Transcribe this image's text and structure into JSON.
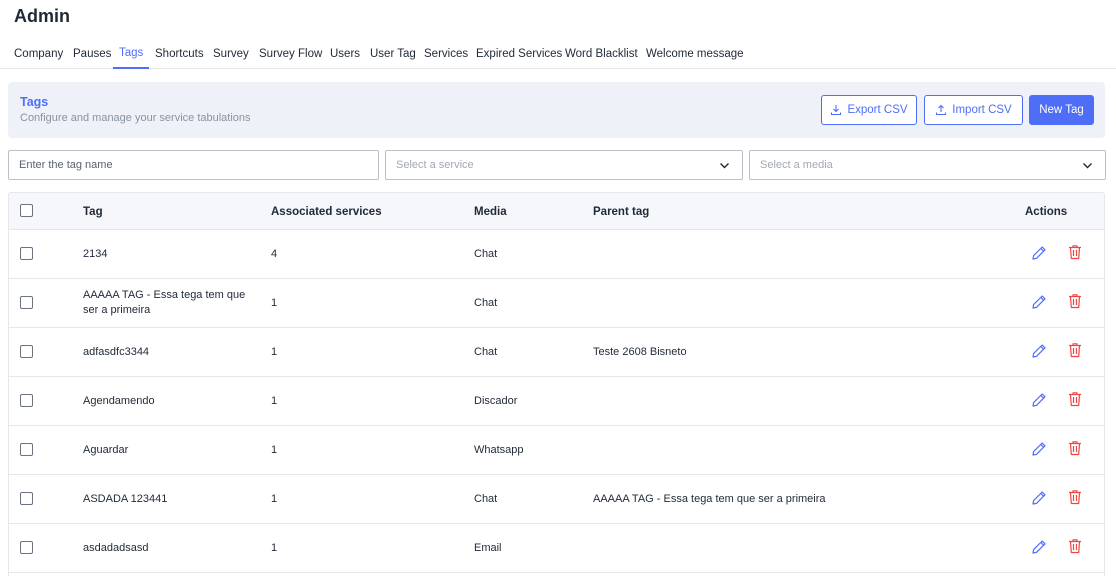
{
  "page": {
    "title": "Admin"
  },
  "tabs": [
    {
      "label": "Company",
      "active": false
    },
    {
      "label": "Pauses",
      "active": false
    },
    {
      "label": "Tags",
      "active": true
    },
    {
      "label": "Shortcuts",
      "active": false
    },
    {
      "label": "Survey",
      "active": false
    },
    {
      "label": "Survey Flow",
      "active": false
    },
    {
      "label": "Users",
      "active": false
    },
    {
      "label": "User Tag",
      "active": false
    },
    {
      "label": "Services",
      "active": false
    },
    {
      "label": "Expired Services",
      "active": false
    },
    {
      "label": "Word Blacklist",
      "active": false
    },
    {
      "label": "Welcome message",
      "active": false
    }
  ],
  "banner": {
    "title": "Tags",
    "subtitle": "Configure and manage your service tabulations",
    "export_label": "Export CSV",
    "import_label": "Import CSV",
    "new_label": "New Tag"
  },
  "filters": {
    "tag_placeholder": "Enter the tag name",
    "service_placeholder": "Select a service",
    "media_placeholder": "Select a media"
  },
  "table": {
    "headers": {
      "tag": "Tag",
      "services": "Associated services",
      "media": "Media",
      "parent": "Parent tag",
      "actions": "Actions"
    },
    "rows": [
      {
        "tag": "2134",
        "services": "4",
        "media": "Chat",
        "parent": ""
      },
      {
        "tag": "AAAAA TAG - Essa tega tem que ser a primeira",
        "services": "1",
        "media": "Chat",
        "parent": ""
      },
      {
        "tag": "adfasdfc3344",
        "services": "1",
        "media": "Chat",
        "parent": "Teste 2608 Bisneto"
      },
      {
        "tag": "Agendamendo",
        "services": "1",
        "media": "Discador",
        "parent": ""
      },
      {
        "tag": "Aguardar",
        "services": "1",
        "media": "Whatsapp",
        "parent": ""
      },
      {
        "tag": "ASDADA 123441",
        "services": "1",
        "media": "Chat",
        "parent": "AAAAA TAG - Essa tega tem que ser a primeira"
      },
      {
        "tag": "asdadadsasd",
        "services": "1",
        "media": "Email",
        "parent": ""
      }
    ]
  },
  "icons": {
    "export": "download-icon",
    "import": "upload-icon",
    "dropdown": "chevron-down-icon",
    "edit": "pencil-icon",
    "delete": "trash-icon"
  },
  "colors": {
    "accent": "#4f6ef7",
    "danger": "#ef4444",
    "banner_bg": "#eef2f8"
  }
}
